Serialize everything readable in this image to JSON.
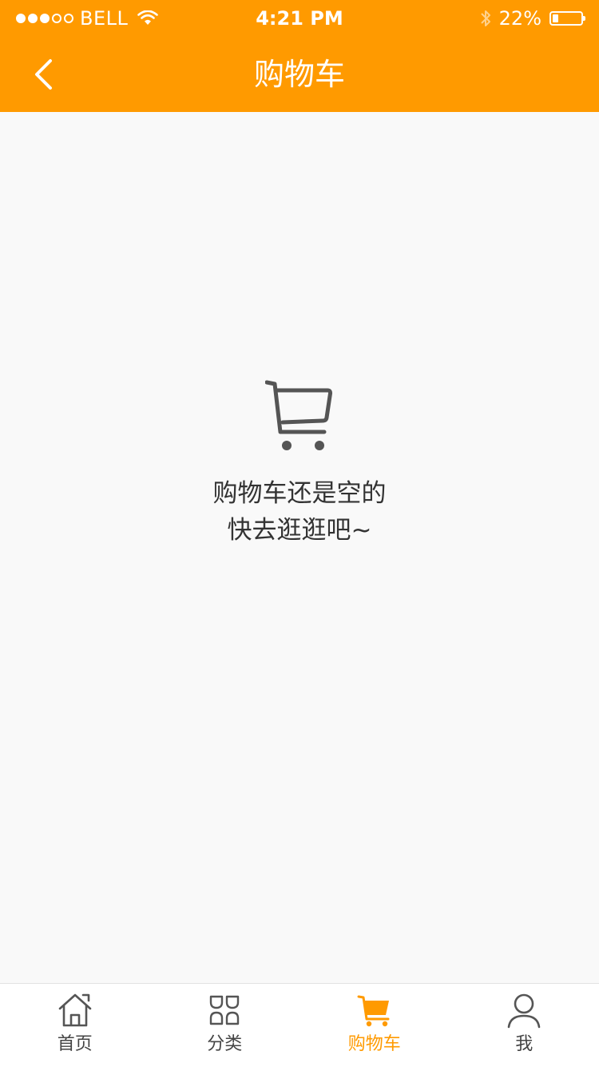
{
  "status_bar": {
    "carrier": "BELL",
    "time": "4:21 PM",
    "battery": "22%",
    "battery_level": 0.22,
    "signal_filled": 3,
    "signal_total": 5
  },
  "header": {
    "title": "购物车"
  },
  "empty_state": {
    "line1": "购物车还是空的",
    "line2": "快去逛逛吧~"
  },
  "tabs": [
    {
      "label": "首页",
      "icon": "home-icon",
      "active": false
    },
    {
      "label": "分类",
      "icon": "category-icon",
      "active": false
    },
    {
      "label": "购物车",
      "icon": "cart-icon",
      "active": true
    },
    {
      "label": "我",
      "icon": "user-icon",
      "active": false
    }
  ],
  "colors": {
    "accent": "#ff9a00",
    "background": "#f9f9f9",
    "tab_inactive": "#444444"
  }
}
